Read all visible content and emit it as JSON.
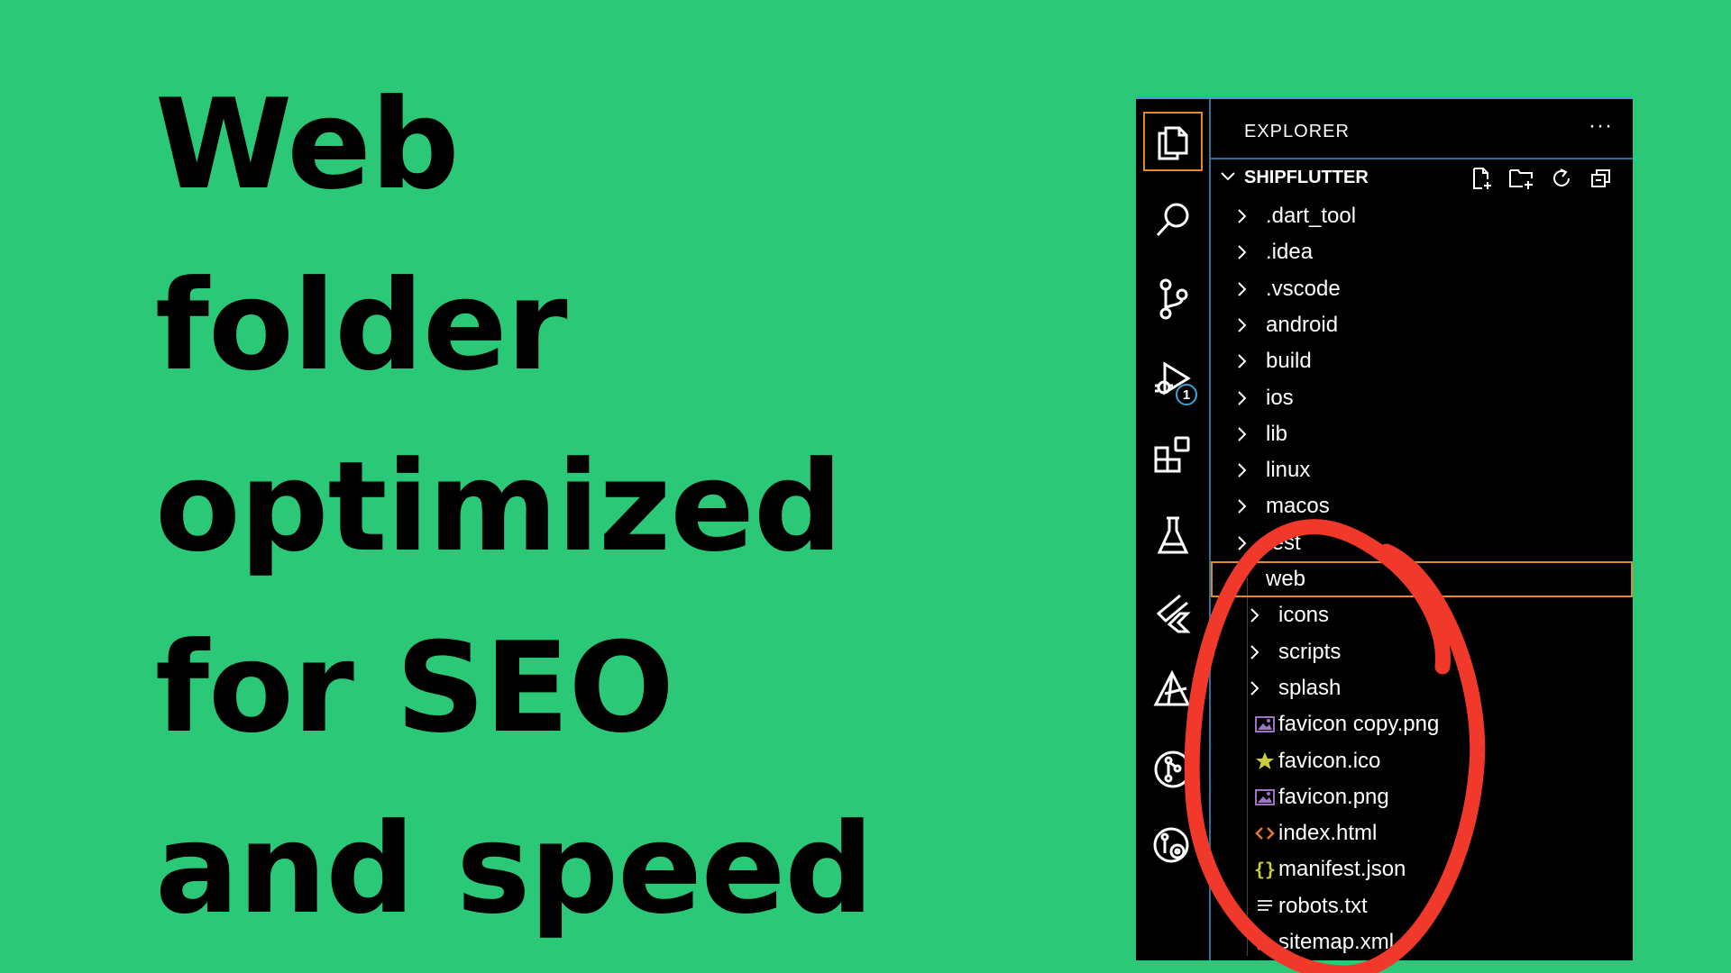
{
  "headline": {
    "lines": [
      "Web",
      "folder",
      "optimized",
      "for SEO",
      "and speed"
    ]
  },
  "activity_bar": {
    "debug_badge": "1"
  },
  "explorer": {
    "title": "EXPLORER",
    "more": "···",
    "section_name": "SHIPFLUTTER",
    "items": [
      {
        "label": ".dart_tool",
        "kind": "folder"
      },
      {
        "label": ".idea",
        "kind": "folder"
      },
      {
        "label": ".vscode",
        "kind": "folder"
      },
      {
        "label": "android",
        "kind": "folder"
      },
      {
        "label": "build",
        "kind": "folder"
      },
      {
        "label": "ios",
        "kind": "folder"
      },
      {
        "label": "lib",
        "kind": "folder"
      },
      {
        "label": "linux",
        "kind": "folder"
      },
      {
        "label": "macos",
        "kind": "folder"
      },
      {
        "label": "test",
        "kind": "folder"
      },
      {
        "label": "web",
        "kind": "folder-open"
      },
      {
        "label": "icons",
        "kind": "folder"
      },
      {
        "label": "scripts",
        "kind": "folder"
      },
      {
        "label": "splash",
        "kind": "folder"
      },
      {
        "label": "favicon copy.png",
        "kind": "image-file"
      },
      {
        "label": "favicon.ico",
        "kind": "star-file"
      },
      {
        "label": "favicon.png",
        "kind": "image-file"
      },
      {
        "label": "index.html",
        "kind": "html-file"
      },
      {
        "label": "manifest.json",
        "kind": "json-file"
      },
      {
        "label": "robots.txt",
        "kind": "text-file"
      },
      {
        "label": "sitemap.xml",
        "kind": "rss-file"
      }
    ]
  },
  "colors": {
    "background": "#2bc977",
    "selection_border": "#e08a2c",
    "annotation": "#f0382b",
    "panel_border": "#3aa3d8"
  }
}
